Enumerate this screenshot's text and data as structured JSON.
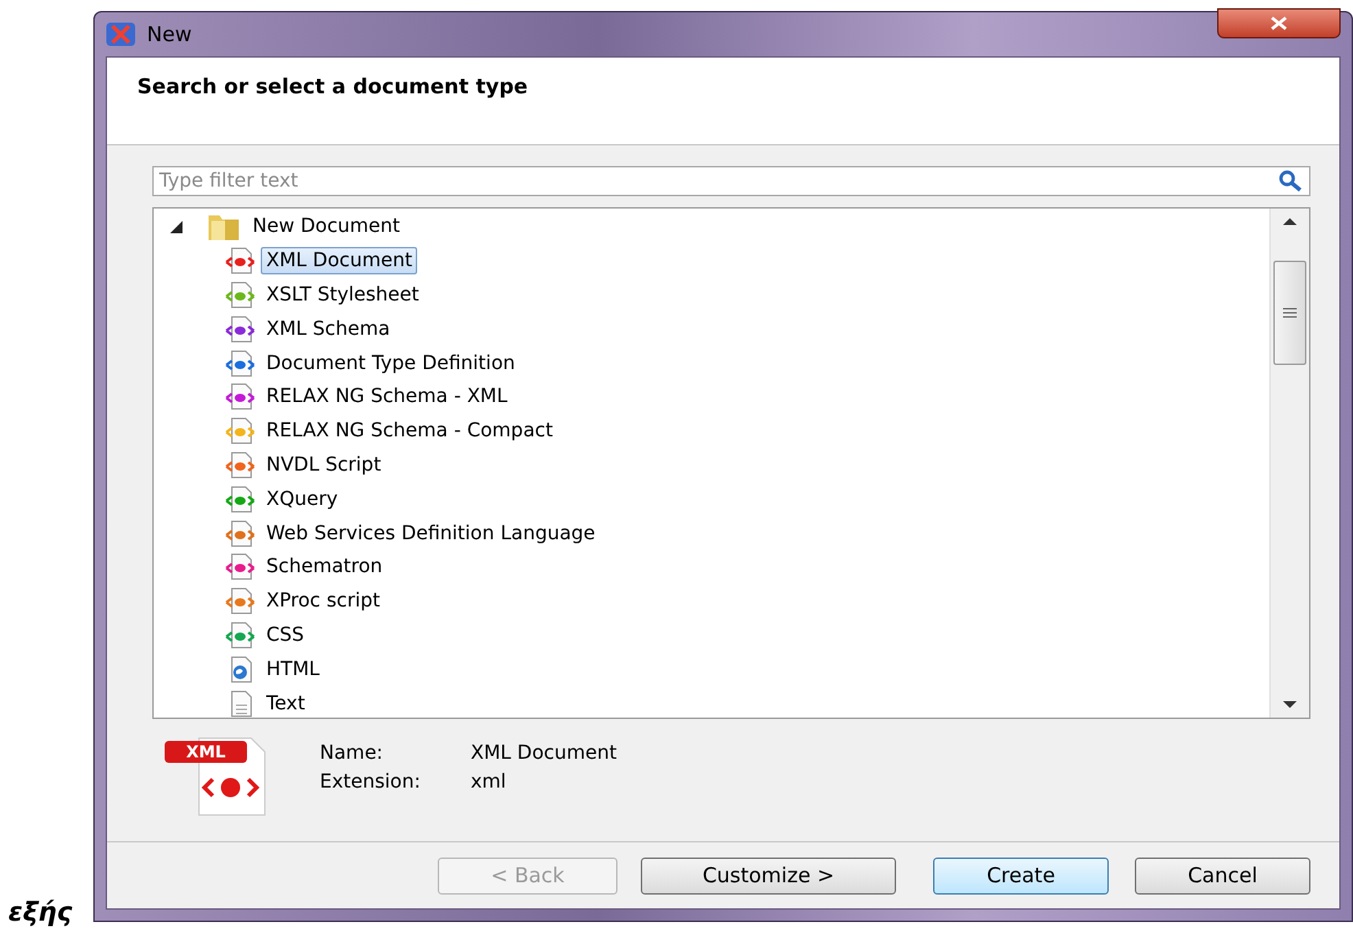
{
  "page_fragment": "εξής",
  "window": {
    "title": "New"
  },
  "header": "Search or select a document type",
  "filter": {
    "placeholder": "Type filter text"
  },
  "tree": [
    {
      "label": "New Document",
      "kind": "folder",
      "expanded": true,
      "selected": false,
      "children": [
        {
          "label": "XML Document",
          "kind": "markup",
          "color": "#e8201c",
          "selected": true
        },
        {
          "label": "XSLT Stylesheet",
          "kind": "markup",
          "color": "#6cb81c",
          "selected": false
        },
        {
          "label": "XML Schema",
          "kind": "markup",
          "color": "#8a2ad8",
          "selected": false
        },
        {
          "label": "Document Type Definition",
          "kind": "markup",
          "color": "#1a6ee0",
          "selected": false
        },
        {
          "label": "RELAX NG Schema - XML",
          "kind": "markup",
          "color": "#c41ad8",
          "selected": false
        },
        {
          "label": "RELAX NG Schema - Compact",
          "kind": "markup",
          "color": "#f4b41c",
          "selected": false
        },
        {
          "label": "NVDL Script",
          "kind": "markup",
          "color": "#f0641c",
          "selected": false
        },
        {
          "label": "XQuery",
          "kind": "markup",
          "color": "#14a814",
          "selected": false
        },
        {
          "label": "Web Services Definition Language",
          "kind": "markup",
          "color": "#e0701c",
          "selected": false
        },
        {
          "label": "Schematron",
          "kind": "markup",
          "color": "#e81c8c",
          "selected": false
        },
        {
          "label": "XProc script",
          "kind": "markup",
          "color": "#e8781c",
          "selected": false
        },
        {
          "label": "CSS",
          "kind": "markup",
          "color": "#14a850",
          "selected": false
        },
        {
          "label": "HTML",
          "kind": "web",
          "selected": false
        },
        {
          "label": "Text",
          "kind": "text",
          "selected": false
        }
      ]
    }
  ],
  "details": {
    "badge": "XML",
    "name_label": "Name:",
    "name_value": "XML Document",
    "extension_label": "Extension:",
    "extension_value": "xml"
  },
  "buttons": [
    {
      "label": "< Back",
      "disabled": true,
      "default": false
    },
    {
      "label": "Customize >",
      "disabled": false,
      "default": false
    },
    {
      "label": "Create",
      "disabled": false,
      "default": true
    },
    {
      "label": "Cancel",
      "disabled": false,
      "default": false
    }
  ]
}
